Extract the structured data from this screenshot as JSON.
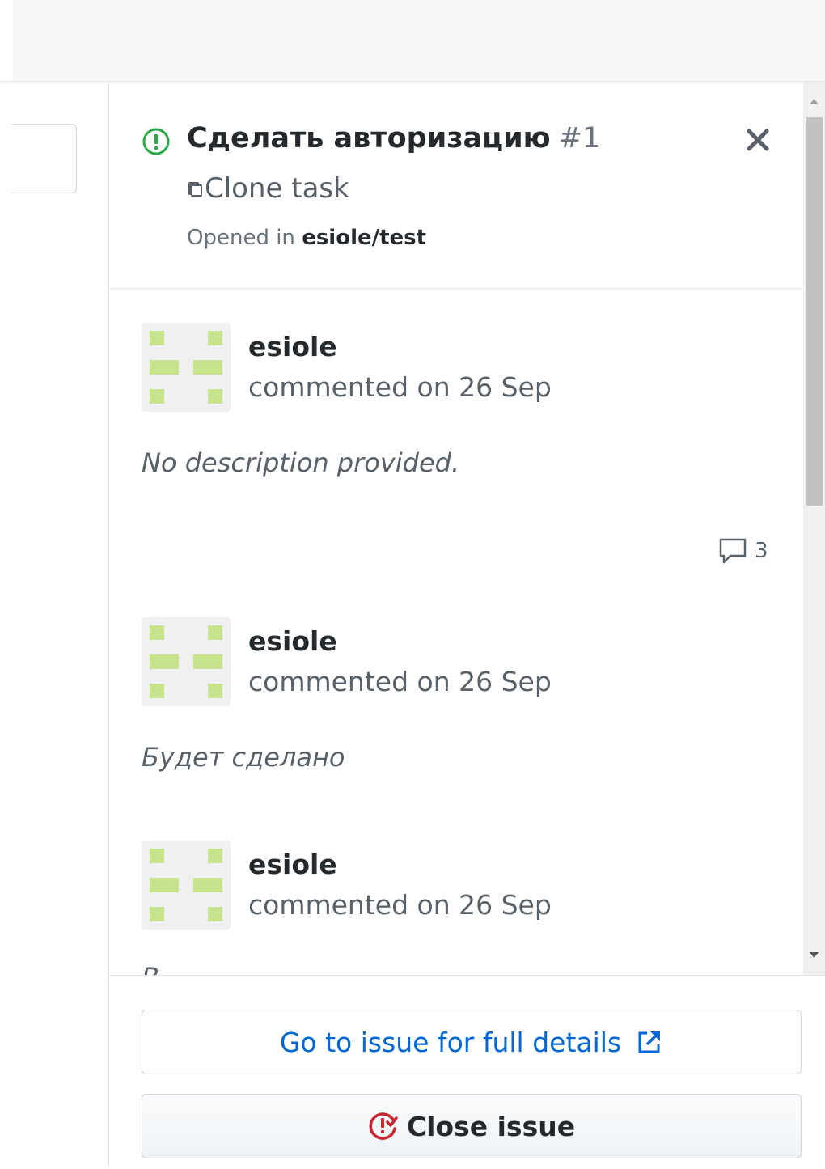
{
  "issue": {
    "title": "Сделать авторизацию",
    "number": "#1",
    "card_title": "Clone task",
    "opened_prefix": "Opened in",
    "repo": "esiole/test"
  },
  "comments": [
    {
      "author": "esiole",
      "meta": "commented on 26 Sep",
      "body": "No description provided."
    },
    {
      "author": "esiole",
      "meta": "commented on 26 Sep",
      "body": "Будет сделано"
    },
    {
      "author": "esiole",
      "meta": "commented on 26 Sep",
      "body": ""
    }
  ],
  "comment_count": "3",
  "partial_text": "В",
  "buttons": {
    "goto_label": "Go to issue for full details",
    "close_label": "Close issue"
  },
  "colors": {
    "open_green": "#28a745",
    "link_blue": "#0366d6",
    "close_red": "#cb2431",
    "avatar_green": "#c6e48b",
    "avatar_bg": "#f0f0f0"
  },
  "icons": {
    "status": "issue-opened-icon",
    "close": "x-icon",
    "card": "project-card-icon",
    "comments": "comment-icon",
    "external": "link-external-icon",
    "close_issue": "issue-closed-icon"
  }
}
